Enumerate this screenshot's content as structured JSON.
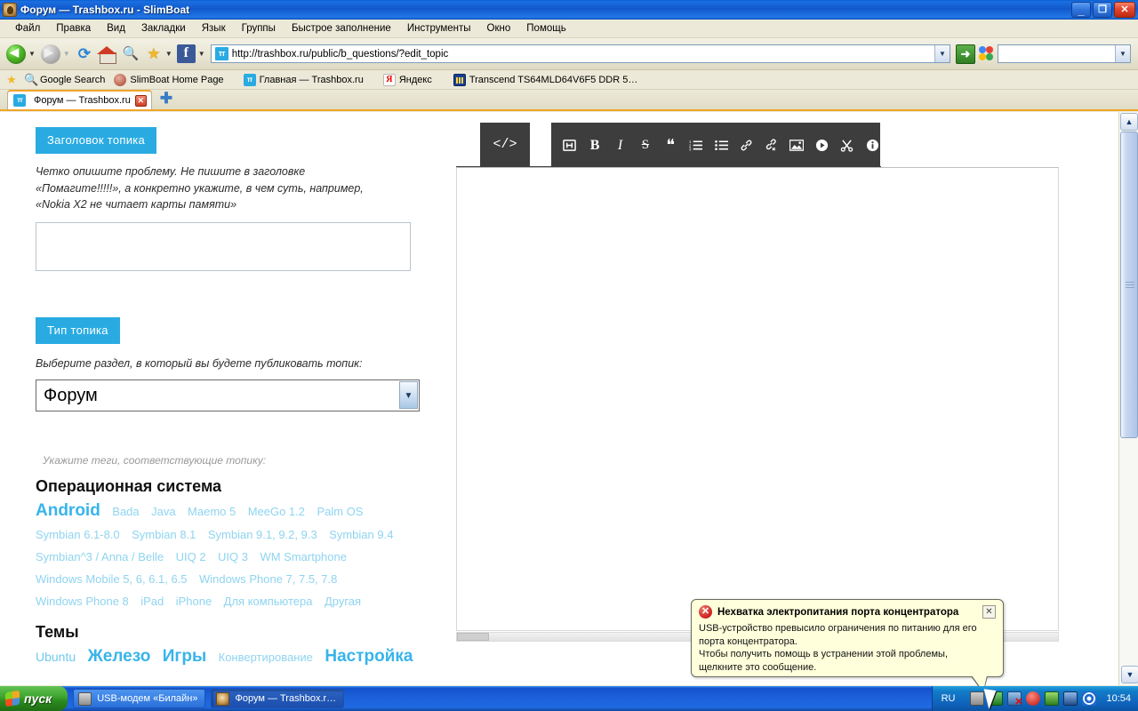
{
  "window": {
    "title": "Форум — Trashbox.ru - SlimBoat",
    "minimize_label": "_",
    "maximize_label": "❐",
    "close_label": "✕"
  },
  "menu": {
    "items": [
      {
        "label": "Файл"
      },
      {
        "label": "Правка"
      },
      {
        "label": "Вид"
      },
      {
        "label": "Закладки"
      },
      {
        "label": "Язык"
      },
      {
        "label": "Группы"
      },
      {
        "label": "Быстрое заполнение"
      },
      {
        "label": "Инструменты"
      },
      {
        "label": "Окно"
      },
      {
        "label": "Помощь"
      }
    ]
  },
  "toolbar": {
    "back_icon": "back-arrow-icon",
    "forward_icon": "forward-arrow-icon",
    "reload_icon": "reload-icon",
    "home_icon": "home-icon",
    "search_icon": "magnifier-icon",
    "bookmark_icon": "star-add-icon",
    "facebook_icon": "facebook-icon",
    "facebook_label": "f",
    "go_icon": "go-arrow-icon",
    "go_label": "➜",
    "google_icon": "google-icon",
    "url": "http://trashbox.ru/public/b_questions/?edit_topic",
    "url_favicon_label": "тт",
    "search_placeholder": "",
    "search_value": ""
  },
  "bookmarks": {
    "items": [
      {
        "label": "Google Search",
        "icon": "google-search-icon"
      },
      {
        "label": "SlimBoat Home Page",
        "icon": "slimboat-icon"
      },
      {
        "label": "Главная — Trashbox.ru",
        "icon": "trashbox-icon",
        "favicon_label": "тт"
      },
      {
        "label": "Яндекс",
        "icon": "yandex-icon",
        "favicon_label": "Я"
      },
      {
        "label": "Transcend TS64MLD64V6F5 DDR 5…",
        "icon": "usb-memory-icon"
      }
    ]
  },
  "tabs": {
    "items": [
      {
        "label": "Форум — Trashbox.ru",
        "favicon_label": "тт",
        "close_label": "✕"
      }
    ],
    "new_tab_label": "✚"
  },
  "page": {
    "title_section": {
      "badge": "Заголовок топика",
      "hint_line1": "Четко опишите проблему. Не пишите в заголовке",
      "hint_line2": "«Помагите!!!!!», а конкретно укажите, в чем суть, например,",
      "hint_line3": "«Nokia X2 не читает карты памяти»",
      "input_value": "",
      "input_placeholder": ""
    },
    "type_section": {
      "badge": "Тип топика",
      "hint": "Выберите раздел, в который вы будете публиковать топик:",
      "selected": "Форум",
      "options": [
        "Форум"
      ],
      "arrow_icon": "chevron-down-icon"
    },
    "tags_section": {
      "hint": "Укажите теги, соответствующие топику:",
      "groups": [
        {
          "heading": "Операционная система",
          "rows": [
            [
              {
                "label": "Android",
                "size": "sz3"
              },
              {
                "label": "Bada",
                "size": "sz1"
              },
              {
                "label": "Java",
                "size": "sz1"
              },
              {
                "label": "Maemo 5",
                "size": "sz1"
              },
              {
                "label": "MeeGo 1.2",
                "size": "sz1"
              },
              {
                "label": "Palm OS",
                "size": "sz1"
              }
            ],
            [
              {
                "label": "Symbian 6.1-8.0",
                "size": "sz1"
              },
              {
                "label": "Symbian 8.1",
                "size": "sz1"
              },
              {
                "label": "Symbian 9.1, 9.2, 9.3",
                "size": "sz1"
              },
              {
                "label": "Symbian 9.4",
                "size": "sz1"
              }
            ],
            [
              {
                "label": "Symbian^3 / Anna / Belle",
                "size": "sz1"
              },
              {
                "label": "UIQ 2",
                "size": "sz1"
              },
              {
                "label": "UIQ 3",
                "size": "sz1"
              },
              {
                "label": "WM Smartphone",
                "size": "sz1"
              }
            ],
            [
              {
                "label": "Windows Mobile 5, 6, 6.1, 6.5",
                "size": "sz1"
              },
              {
                "label": "Windows Phone 7, 7.5, 7.8",
                "size": "sz1"
              }
            ],
            [
              {
                "label": "Windows Phone 8",
                "size": "sz1"
              },
              {
                "label": "iPad",
                "size": "sz1"
              },
              {
                "label": "iPhone",
                "size": "sz1"
              },
              {
                "label": "Для компьютера",
                "size": "sz1"
              },
              {
                "label": "Другая",
                "size": "sz1"
              }
            ]
          ]
        },
        {
          "heading": "Темы",
          "rows": [
            [
              {
                "label": "Ubuntu",
                "size": "sz1"
              },
              {
                "label": "Железо",
                "size": "sz3"
              },
              {
                "label": "Игры",
                "size": "sz3"
              },
              {
                "label": "Конвертирование",
                "size": "sz1"
              },
              {
                "label": "Настройка",
                "size": "sz3"
              }
            ]
          ]
        }
      ]
    },
    "editor": {
      "source_tab_label": "</>",
      "buttons": [
        {
          "icon": "heading-icon",
          "label": "H"
        },
        {
          "icon": "bold-icon",
          "label": "B"
        },
        {
          "icon": "italic-icon",
          "label": "I"
        },
        {
          "icon": "strikethrough-icon",
          "label": "S"
        },
        {
          "icon": "blockquote-icon",
          "label": "❝"
        },
        {
          "icon": "ordered-list-icon",
          "label": "1."
        },
        {
          "icon": "unordered-list-icon",
          "label": "•"
        },
        {
          "icon": "link-icon",
          "label": "🔗"
        },
        {
          "icon": "unlink-icon",
          "label": "⛓"
        },
        {
          "icon": "image-icon",
          "label": "🖼"
        },
        {
          "icon": "video-icon",
          "label": "▶"
        },
        {
          "icon": "cut-icon",
          "label": "✂"
        },
        {
          "icon": "info-icon",
          "label": "i"
        }
      ],
      "content": ""
    }
  },
  "scrollbar": {
    "up_icon": "chevron-up-icon",
    "down_icon": "chevron-down-icon"
  },
  "notification": {
    "error_icon": "error-icon",
    "title": "Нехватка электропитания порта концентратора",
    "close_label": "✕",
    "line1": "USB-устройство превысило ограничения по питанию для его",
    "line2": "порта концентратора.",
    "line3": "Чтобы получить помощь в устранении этой проблемы,",
    "line4": "щелкните это сообщение."
  },
  "taskbar": {
    "start_label": "пуск",
    "buttons": [
      {
        "label": "USB-модем «Билайн»",
        "icon": "modem-icon",
        "active": false
      },
      {
        "label": "Форум — Trashbox.r…",
        "icon": "slimboat-icon",
        "active": true
      }
    ],
    "tray": {
      "language": "RU",
      "icons": [
        "usb-icon",
        "network-icon",
        "network-error-icon",
        "shield-icon",
        "flash-icon",
        "monitor-icon",
        "sound-icon"
      ],
      "clock": "10:54"
    }
  },
  "colors": {
    "accent": "#29abe2",
    "tag_light": "#8fd4f0",
    "tag_strong": "#38b4ea",
    "editor_bg": "#3d3d3d",
    "titlebar": "#1159cc",
    "balloon_bg": "#ffffdc"
  }
}
